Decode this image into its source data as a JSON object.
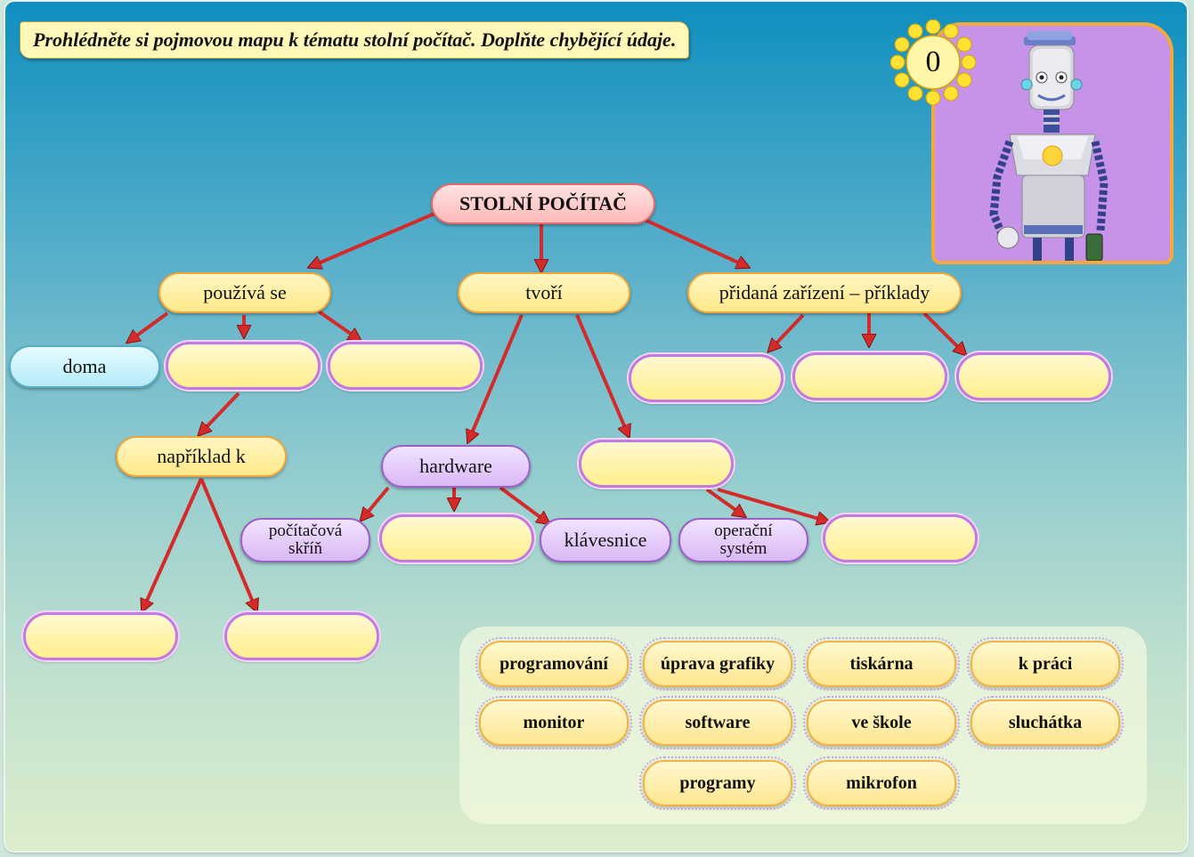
{
  "instruction": "Prohlédněte si pojmovou mapu k tématu stolní počítač. Doplňte chybějící údaje.",
  "score": "0",
  "map": {
    "root": "STOLNÍ POČÍTAČ",
    "uses": "používá se",
    "forms": "tvoří",
    "added_devices": "přidaná zařízení – příklady",
    "home": "doma",
    "for_example": "například k",
    "hardware": "hardware",
    "computer_case": "počítačová skříň",
    "keyboard": "klávesnice",
    "operating_system": "operační systém"
  },
  "word_bank": [
    "programování",
    "úprava grafiky",
    "tiskárna",
    "k práci",
    "monitor",
    "software",
    "ve škole",
    "sluchátka",
    "programy",
    "mikrofon"
  ],
  "colors": {
    "arrow": "#d42a2a",
    "slot_border": "#c27be0",
    "panel": "#c693e8"
  }
}
